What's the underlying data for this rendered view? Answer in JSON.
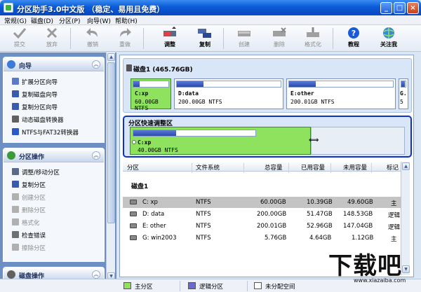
{
  "window": {
    "title": "分区助手3.0中文版 （稳定、易用且免费）",
    "min": "_",
    "max": "□",
    "close": "×"
  },
  "menu": [
    "常规(G)",
    "磁盘(D)",
    "分区(P)",
    "向导(W)",
    "帮助(H)"
  ],
  "toolbar": {
    "commit": "提交",
    "discard": "放弃",
    "undo": "撤销",
    "redo": "重做",
    "adjust": "调整",
    "copy": "复制",
    "create": "创建",
    "delete": "删除",
    "format": "格式化",
    "tutorial": "教程",
    "follow": "关注我"
  },
  "wizard": {
    "title": "向导",
    "items": [
      "扩展分区向导",
      "复制磁盘向导",
      "复制分区向导",
      "动态磁盘转换器",
      "NTFS与FAT32转换器"
    ]
  },
  "partition_ops": {
    "title": "分区操作",
    "items": [
      "调整/移动分区",
      "复制分区",
      "创建分区",
      "删除分区",
      "格式化",
      "检查错误",
      "擦除分区"
    ]
  },
  "disk_ops": {
    "title": "磁盘操作"
  },
  "disk": {
    "title": "磁盘1 (465.76GB)",
    "partitions": [
      {
        "name": "C:xp",
        "info": "60.00GB NTFS",
        "used": 0.17
      },
      {
        "name": "D:data",
        "info": "200.00GB NTFS",
        "used": 0.26
      },
      {
        "name": "E:other",
        "info": "200.01GB NTFS",
        "used": 0.26
      },
      {
        "name": "G.",
        "info": "5",
        "used": 0.8
      }
    ]
  },
  "quick": {
    "title": "分区快速调整区",
    "name": "C:xp",
    "info": "40.00GB NTFS",
    "used": 0.35
  },
  "table": {
    "headers": [
      "分区",
      "文件系统",
      "总容量",
      "已用容量",
      "未用容量",
      "标记"
    ],
    "group": "磁盘1",
    "rows": [
      {
        "name": "C: xp",
        "fs": "NTFS",
        "total": "60.00GB",
        "used": "10.39GB",
        "free": "49.60GB",
        "flag": "主"
      },
      {
        "name": "D: data",
        "fs": "NTFS",
        "total": "200.00GB",
        "used": "51.47GB",
        "free": "148.53GB",
        "flag": "逻辑"
      },
      {
        "name": "E: other",
        "fs": "NTFS",
        "total": "200.01GB",
        "used": "52.96GB",
        "free": "147.04GB",
        "flag": "逻辑"
      },
      {
        "name": "G: win2003",
        "fs": "NTFS",
        "total": "5.76GB",
        "used": "4.64GB",
        "free": "1.12GB",
        "flag": "主"
      }
    ]
  },
  "legend": {
    "primary": "主分区",
    "logical": "逻辑分区",
    "unallocated": "未分配空间"
  },
  "watermark": {
    "big": "下载吧",
    "url": "www.xiazaiba.com"
  },
  "colors": {
    "primary": "#8ee25e",
    "logical": "#6a6ad0",
    "unallocated": "#ffffff",
    "selection": "#1030c8"
  }
}
